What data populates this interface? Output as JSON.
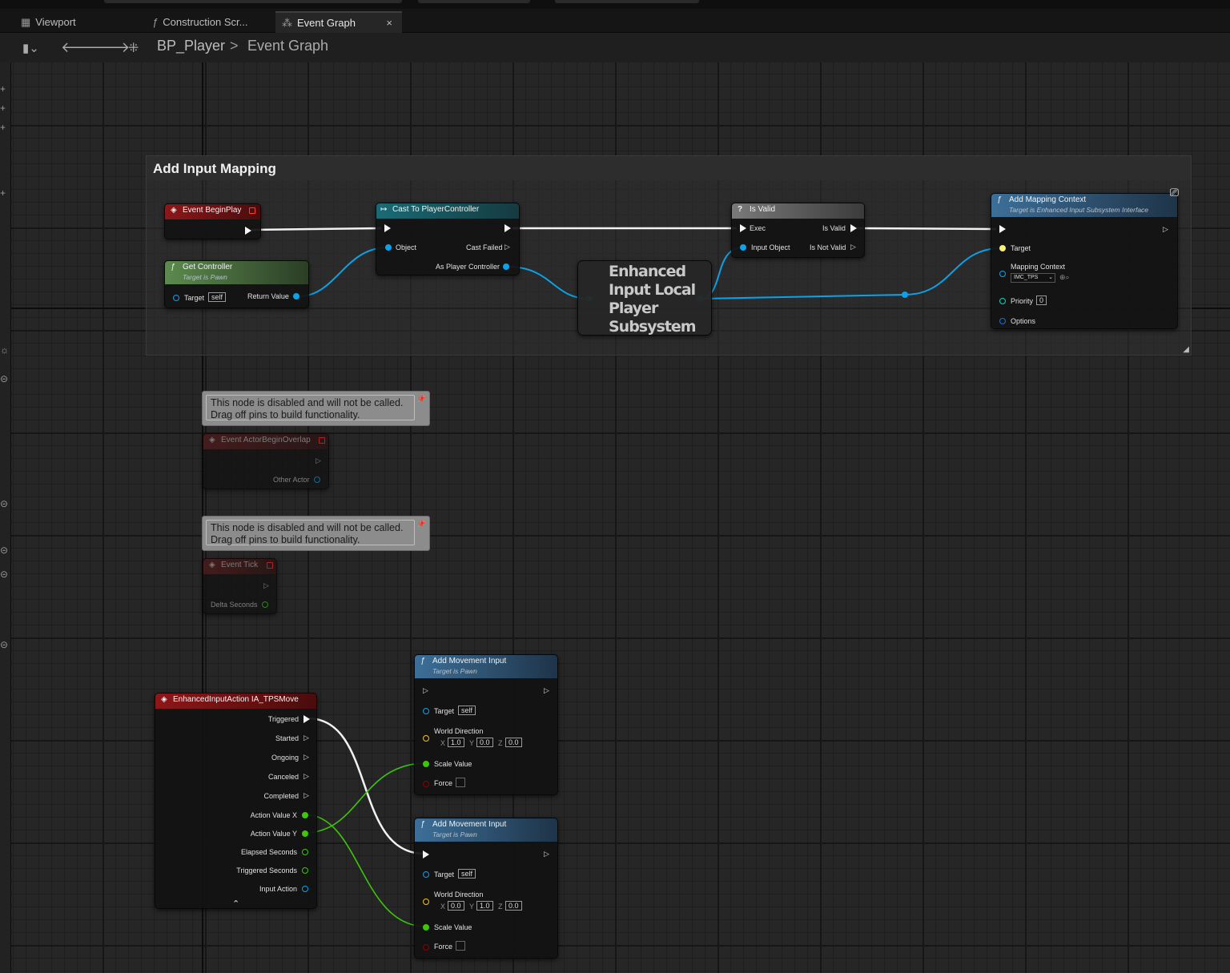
{
  "tabs": [
    {
      "label": "Viewport",
      "icon": "grid-icon"
    },
    {
      "label": "Construction Scr...",
      "icon": "function-icon"
    },
    {
      "label": "Event Graph",
      "icon": "graph-icon"
    }
  ],
  "tab_close": "×",
  "breadcrumb": {
    "blueprint": "BP_Player",
    "graph": "Event Graph",
    "separator": ">"
  },
  "comment": {
    "title": "Add Input Mapping"
  },
  "nodes": {
    "begin_play": {
      "title": "Event BeginPlay"
    },
    "get_controller": {
      "title": "Get Controller",
      "subtitle": "Target is Pawn",
      "target_label": "Target",
      "target_value": "self",
      "return_label": "Return Value"
    },
    "cast": {
      "title": "Cast To PlayerController",
      "object_label": "Object",
      "failed_label": "Cast Failed",
      "as_label": "As Player Controller"
    },
    "subsystem": {
      "line1": "Enhanced",
      "line2": "Input Local",
      "line3": "Player",
      "line4": "Subsystem"
    },
    "is_valid": {
      "title": "Is Valid",
      "exec_label": "Exec",
      "input_label": "Input Object",
      "valid_label": "Is Valid",
      "not_valid_label": "Is Not Valid"
    },
    "add_mapping": {
      "title": "Add Mapping Context",
      "subtitle": "Target is Enhanced Input Subsystem Interface",
      "target_label": "Target",
      "context_label": "Mapping Context",
      "context_value": "IMC_TPS",
      "priority_label": "Priority",
      "priority_value": "0",
      "options_label": "Options"
    },
    "disabled_note": {
      "line1": "This node is disabled and will not be called.",
      "line2": "Drag off pins to build functionality."
    },
    "begin_overlap": {
      "title": "Event ActorBeginOverlap",
      "pin_label": "Other Actor"
    },
    "tick": {
      "title": "Event Tick",
      "pin_label": "Delta Seconds"
    },
    "input_action": {
      "title": "EnhancedInputAction IA_TPSMove",
      "pins": [
        "Triggered",
        "Started",
        "Ongoing",
        "Canceled",
        "Completed",
        "Action Value X",
        "Action Value Y",
        "Elapsed Seconds",
        "Triggered Seconds",
        "Input Action"
      ]
    },
    "move1": {
      "title": "Add Movement Input",
      "subtitle": "Target is Pawn",
      "target_label": "Target",
      "target_value": "self",
      "dir_label": "World Direction",
      "x": "1.0",
      "y": "0.0",
      "z": "0.0",
      "scale_label": "Scale Value",
      "force_label": "Force"
    },
    "move2": {
      "title": "Add Movement Input",
      "subtitle": "Target is Pawn",
      "target_label": "Target",
      "target_value": "self",
      "dir_label": "World Direction",
      "x": "0.0",
      "y": "1.0",
      "z": "0.0",
      "scale_label": "Scale Value",
      "force_label": "Force"
    }
  },
  "axis_letters": {
    "x": "X",
    "y": "Y",
    "z": "Z"
  },
  "colors": {
    "exec": "#ffffff",
    "object_pin": "#00a8f4",
    "float_pin": "#38d500",
    "vector_pin": "#f5c400",
    "bool_pin": "#8b0000",
    "struct_pin": "#00d8c0",
    "event_header": "#8d1719",
    "pure_header": "#5c8a4e",
    "cast_header": "#1a6b76",
    "function_header": "#3d6f98"
  }
}
